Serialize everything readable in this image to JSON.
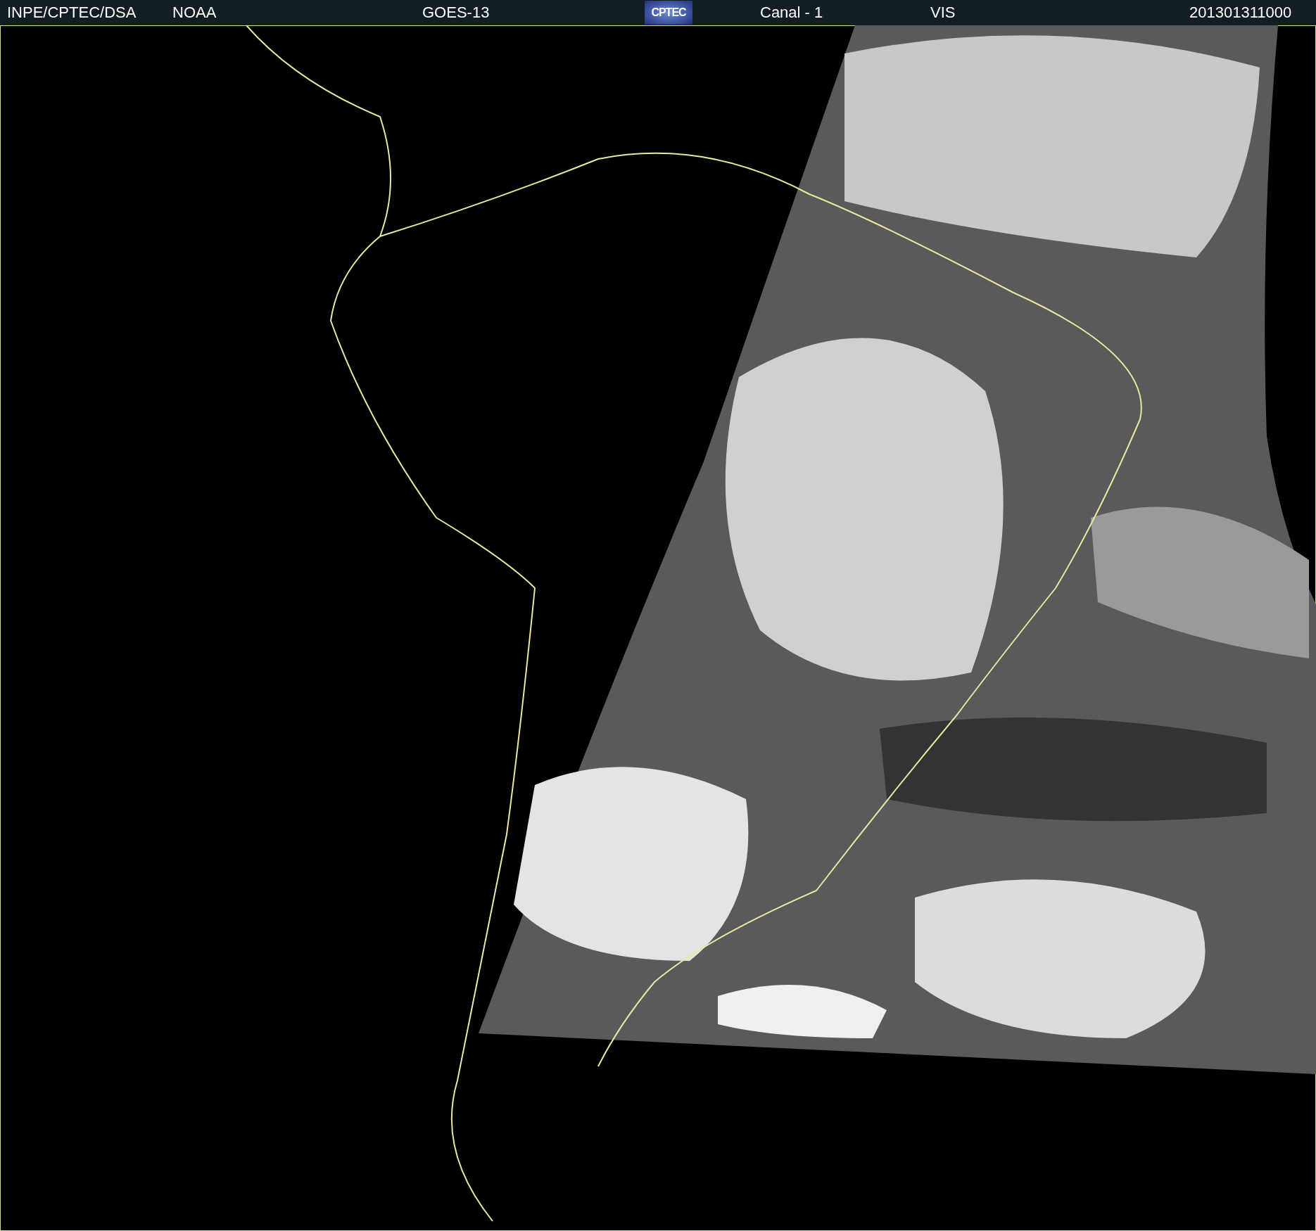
{
  "header": {
    "items": [
      {
        "kind": "text",
        "text": "INPE/CPTEC/DSA"
      },
      {
        "kind": "text",
        "text": "NOAA"
      },
      {
        "kind": "text",
        "text": "GOES-13"
      },
      {
        "kind": "logo",
        "text": "CPTEC"
      },
      {
        "kind": "text",
        "text": "Canal - 1"
      },
      {
        "kind": "text",
        "text": "VIS"
      },
      {
        "kind": "text",
        "text": "201301311000"
      }
    ]
  }
}
